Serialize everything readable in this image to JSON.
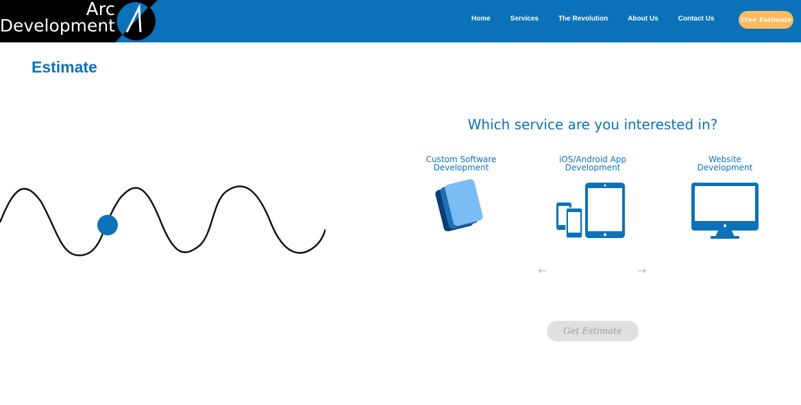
{
  "header": {
    "logo": {
      "line1": "Arc",
      "line2": "Development"
    },
    "tabs": [
      {
        "label": "Home"
      },
      {
        "label": "Services"
      },
      {
        "label": "The Revolution"
      },
      {
        "label": "About Us"
      },
      {
        "label": "Contact Us"
      }
    ],
    "free_estimate_label": "Free Estimate"
  },
  "main": {
    "title": "Estimate",
    "question": "Which service are you interested in?",
    "services": [
      {
        "label": "Custom Software\nDevelopment",
        "icon": "software-icon"
      },
      {
        "label": "iOS/Android App\nDevelopment",
        "icon": "mobile-devices-icon"
      },
      {
        "label": "Website\nDevelopment",
        "icon": "desktop-icon"
      }
    ],
    "prev_icon": "arrow-back-icon",
    "next_icon": "arrow-forward-icon",
    "get_estimate_label": "Get Estimate"
  },
  "colors": {
    "brand_blue": "#0b72b9",
    "orange": "#ffba60",
    "disabled_gray": "#e0e0e0"
  }
}
